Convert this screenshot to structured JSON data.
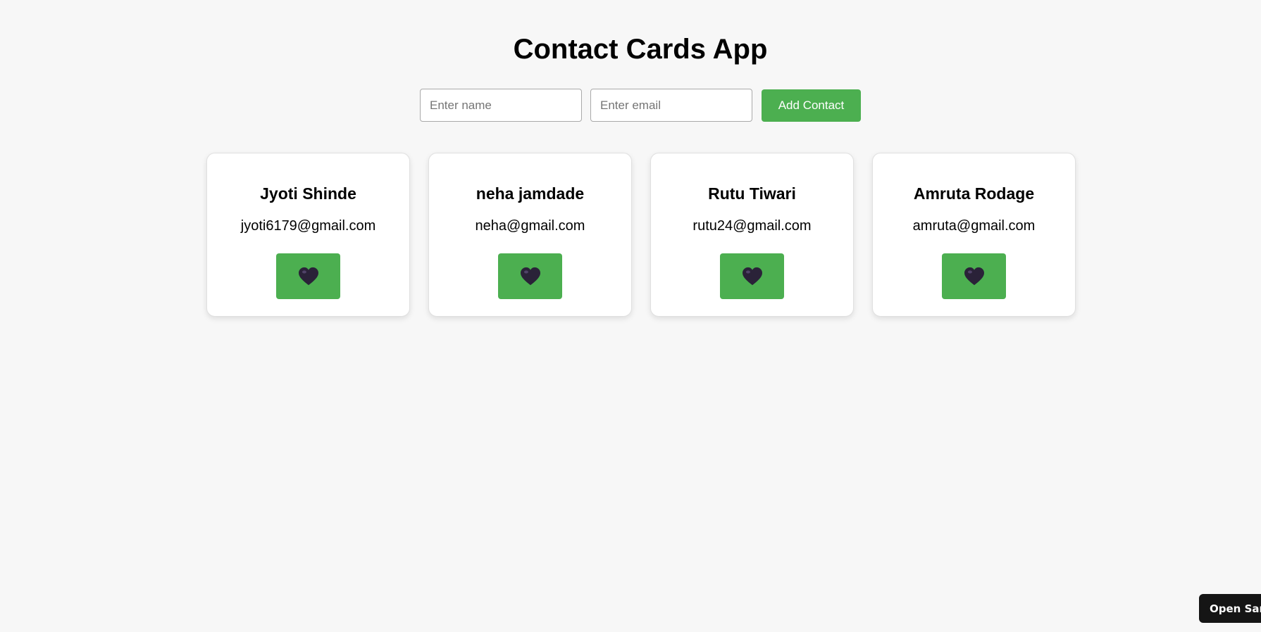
{
  "header": {
    "title": "Contact Cards App"
  },
  "form": {
    "name_placeholder": "Enter name",
    "email_placeholder": "Enter email",
    "add_label": "Add Contact",
    "accent_color": "#4caf50"
  },
  "contacts": [
    {
      "name": "Jyoti Shinde",
      "email": "jyoti6179@gmail.com",
      "like_icon": "black-heart-icon"
    },
    {
      "name": "neha jamdade",
      "email": "neha@gmail.com",
      "like_icon": "black-heart-icon"
    },
    {
      "name": "Rutu Tiwari",
      "email": "rutu24@gmail.com",
      "like_icon": "black-heart-icon"
    },
    {
      "name": "Amruta Rodage",
      "email": "amruta@gmail.com",
      "like_icon": "black-heart-icon"
    }
  ],
  "sandbox": {
    "label": "Open Sandbox"
  }
}
